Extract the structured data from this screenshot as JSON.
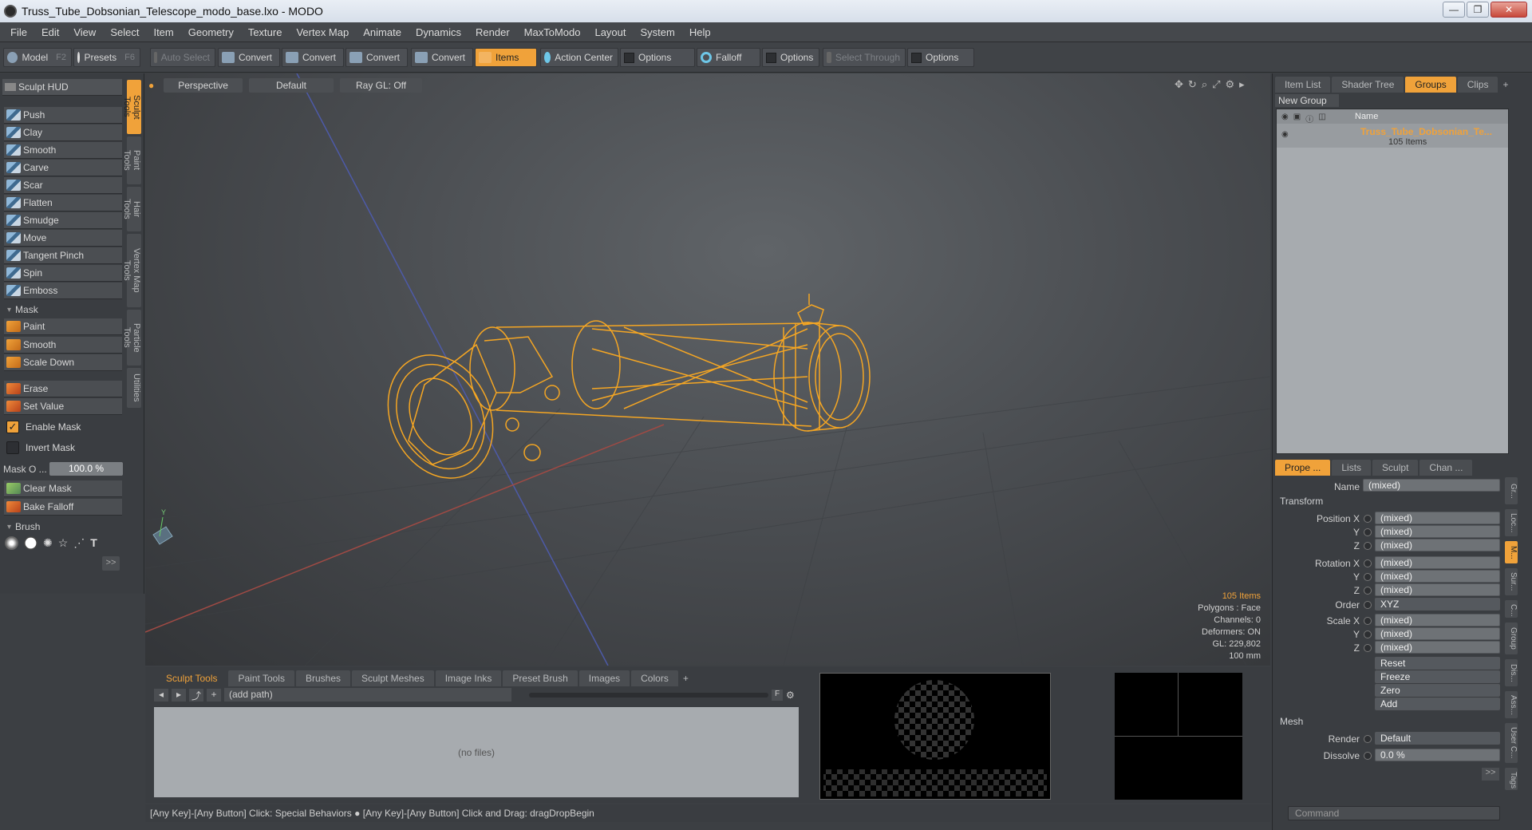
{
  "window": {
    "title": "Truss_Tube_Dobsonian_Telescope_modo_base.lxo - MODO",
    "controls": [
      "—",
      "❐",
      "✕"
    ]
  },
  "menu": [
    "File",
    "Edit",
    "View",
    "Select",
    "Item",
    "Geometry",
    "Texture",
    "Vertex Map",
    "Animate",
    "Dynamics",
    "Render",
    "MaxToModo",
    "Layout",
    "System",
    "Help"
  ],
  "toolbar": {
    "model": "Model",
    "model_key": "F2",
    "presets": "Presets",
    "presets_key": "F6",
    "auto_select": "Auto Select",
    "convert": "Convert",
    "items": "Items",
    "action_center": "Action Center",
    "options": "Options",
    "falloff": "Falloff",
    "select_through": "Select Through"
  },
  "left": {
    "hud": "Sculpt HUD",
    "tools": [
      "Push",
      "Clay",
      "Smooth",
      "Carve",
      "Scar",
      "Flatten",
      "Smudge",
      "Move",
      "Tangent Pinch",
      "Spin",
      "Emboss"
    ],
    "mask_header": "Mask",
    "mask_tools": [
      "Paint",
      "Smooth",
      "Scale Down"
    ],
    "erase": "Erase",
    "set_value": "Set Value",
    "enable_mask": "Enable Mask",
    "invert_mask": "Invert Mask",
    "mask_opacity_label": "Mask O ...",
    "mask_opacity_value": "100.0 %",
    "clear_mask": "Clear Mask",
    "bake_falloff": "Bake Falloff",
    "brush_header": "Brush",
    "more": ">>",
    "vtabs": [
      "Sculpt Tools",
      "Paint Tools",
      "Hair Tools",
      "Vertex Map Tools",
      "Particle Tools",
      "Utilities"
    ]
  },
  "viewport": {
    "view": "Perspective",
    "shading": "Default",
    "raygl": "Ray GL: Off",
    "info": {
      "items": "105 Items",
      "polygons": "Polygons : Face",
      "channels": "Channels: 0",
      "deformers": "Deformers: ON",
      "gl": "GL: 229,802",
      "scale": "100 mm"
    },
    "axis_y": "Y"
  },
  "right": {
    "tabs": [
      "Item List",
      "Shader Tree",
      "Groups",
      "Clips"
    ],
    "new_group": "New Group",
    "col_name": "Name",
    "group_name": "Truss_Tube_Dobsonian_Te...",
    "group_count": "105 Items",
    "prop_tabs": [
      "Prope ...",
      "Lists",
      "Sculpt",
      "Chan ..."
    ],
    "name_label": "Name",
    "name_value": "(mixed)",
    "transform": "Transform",
    "position_x": "Position X",
    "rotation_x": "Rotation X",
    "scale_x": "Scale X",
    "y": "Y",
    "z": "Z",
    "mixed": "(mixed)",
    "order": "Order",
    "order_value": "XYZ",
    "reset": "Reset",
    "freeze": "Freeze",
    "zero": "Zero",
    "add": "Add",
    "mesh": "Mesh",
    "render": "Render",
    "render_value": "Default",
    "dissolve": "Dissolve",
    "dissolve_value": "0.0 %",
    "side_tabs": [
      "Gr...",
      "Loc...",
      "M...",
      "Sur...",
      "C...",
      "Group",
      "Dis...",
      "Ass...",
      "User C...",
      "Tags"
    ],
    "more": ">>"
  },
  "bottom": {
    "tabs": [
      "Sculpt Tools",
      "Paint Tools",
      "Brushes",
      "Sculpt Meshes",
      "Image Inks",
      "Preset Brush",
      "Images",
      "Colors"
    ],
    "path": "(add path)",
    "no_files": "(no files)",
    "f": "F"
  },
  "status": "[Any Key]-[Any Button] Click: Special Behaviors ● [Any Key]-[Any Button] Click and Drag: dragDropBegin",
  "command_placeholder": "Command",
  "colors": {
    "accent": "#f0a23a",
    "wire": "#f5a623"
  }
}
